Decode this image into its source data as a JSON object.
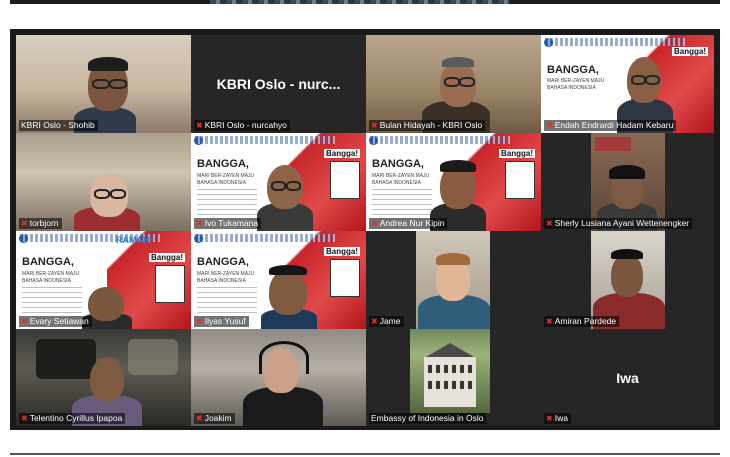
{
  "participants": [
    {
      "name": "KBRI Oslo - Shohib",
      "type": "video",
      "active": true
    },
    {
      "name": "KBRI Oslo - nurcahyo",
      "type": "name",
      "display": "KBRI Oslo - nurc..."
    },
    {
      "name": "Bulan Hidayah - KBRI Oslo",
      "type": "video"
    },
    {
      "name": "Endah Endrardi Hadam Kebaru",
      "type": "slide"
    },
    {
      "name": "torbjorn",
      "type": "video"
    },
    {
      "name": "Ivo Tukamana",
      "type": "slide"
    },
    {
      "name": "Andrea Nur Kipin",
      "type": "slide"
    },
    {
      "name": "Sherly Lusiana Ayani Wettenengker",
      "type": "video"
    },
    {
      "name": "Evary Setiawan",
      "type": "slide"
    },
    {
      "name": "Ilyas Yusuf",
      "type": "slide"
    },
    {
      "name": "Jame",
      "type": "video"
    },
    {
      "name": "Amiran Pardede",
      "type": "video"
    },
    {
      "name": "Telentino Cyrillus Ipapoa",
      "type": "video"
    },
    {
      "name": "Joakim",
      "type": "video"
    },
    {
      "name": "Embassy of Indonesia in Oslo",
      "type": "video"
    },
    {
      "name": "Iwa",
      "type": "name",
      "display": "Iwa"
    }
  ],
  "slide": {
    "title_line1": "BANGGA,",
    "title_line2": "MARI BER-ZAYEN MAJU",
    "title_line3": "BAHASA INDONESIA",
    "poster_title": "Bangga!",
    "ramah": "RAMAH"
  },
  "colors": {
    "active_border": "#2ed06e",
    "mic_muted": "#e0302b",
    "slide_red": "#c9252b"
  },
  "icons": {
    "mic": "mic-muted-icon"
  }
}
